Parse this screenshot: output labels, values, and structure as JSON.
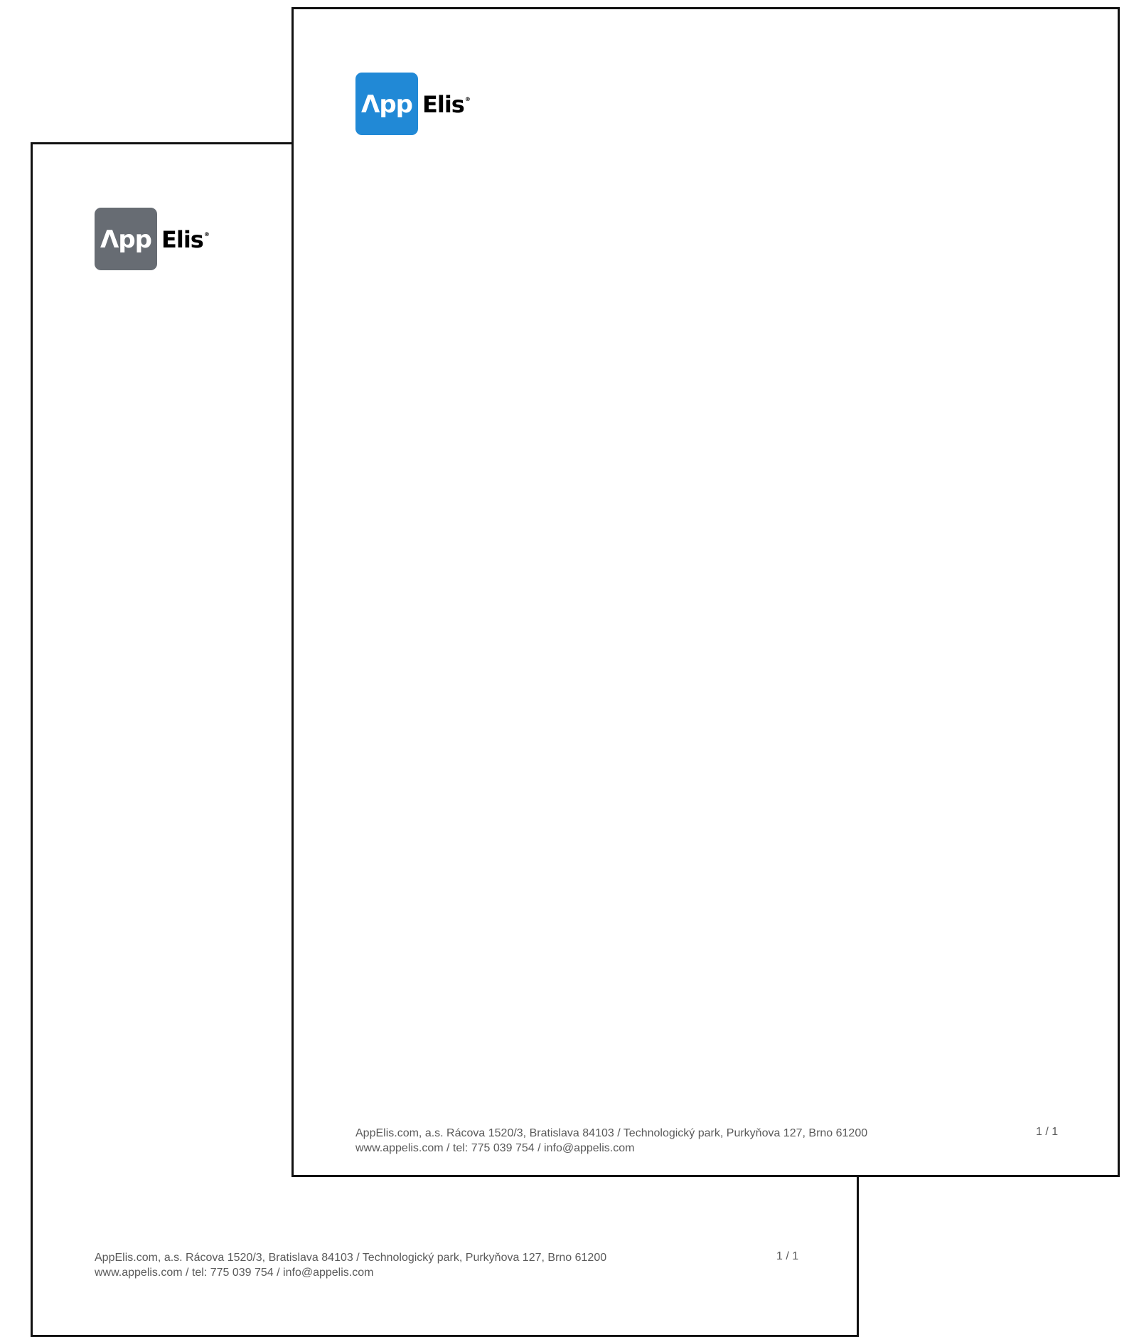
{
  "colors": {
    "logo_blue": "#2189d6",
    "logo_gray": "#676c73",
    "footer_text": "#5a5a5a",
    "sheet_border": "#111111"
  },
  "back_sheet": {
    "logo": {
      "badge_text": "Λpp",
      "word": "Elis",
      "mark": "®"
    },
    "footer": {
      "line1": "AppElis.com, a.s. Rácova 1520/3, Bratislava 84103 / Technologický park, Purkyňova 127, Brno 61200",
      "line2": "www.appelis.com / tel: 775 039 754 / info@appelis.com",
      "page": "1 / 1"
    }
  },
  "front_sheet": {
    "logo": {
      "badge_text": "Λpp",
      "word": "Elis",
      "mark": "®"
    },
    "footer": {
      "line1": "AppElis.com, a.s. Rácova 1520/3, Bratislava 84103 / Technologický park, Purkyňova 127, Brno 61200",
      "line2": "www.appelis.com / tel: 775 039 754 / info@appelis.com",
      "page": "1 / 1"
    }
  }
}
